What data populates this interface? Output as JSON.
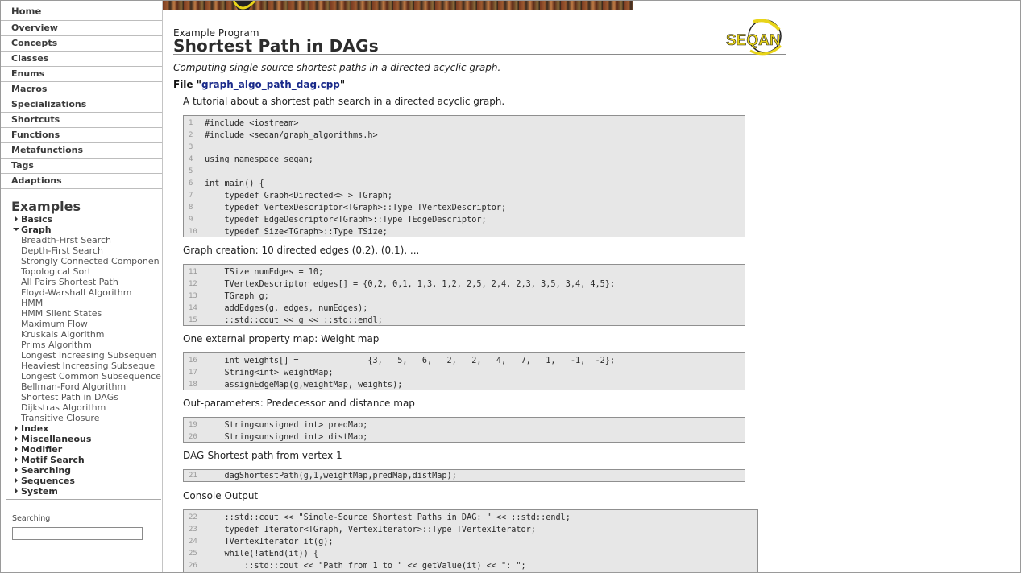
{
  "sidebar": {
    "nav": [
      {
        "label": "Home"
      },
      {
        "label": "Overview"
      },
      {
        "label": "Concepts"
      },
      {
        "label": "Classes"
      },
      {
        "label": "Enums"
      },
      {
        "label": "Macros"
      },
      {
        "label": "Specializations"
      },
      {
        "label": "Shortcuts"
      },
      {
        "label": "Functions"
      },
      {
        "label": "Metafunctions"
      },
      {
        "label": "Tags"
      },
      {
        "label": "Adaptions"
      }
    ],
    "examples_heading": "Examples",
    "categories_before": [
      {
        "label": "Basics",
        "expanded": false
      }
    ],
    "graph_category": {
      "label": "Graph",
      "expanded": true
    },
    "graph_items": [
      "Breadth-First Search",
      "Depth-First Search",
      "Strongly Connected Componen",
      "Topological Sort",
      "All Pairs Shortest Path",
      "Floyd-Warshall Algorithm",
      "HMM",
      "HMM Silent States",
      "Maximum Flow",
      "Kruskals Algorithm",
      "Prims Algorithm",
      "Longest Increasing Subsequen",
      "Heaviest Increasing Subseque",
      "Longest Common Subsequence",
      "Bellman-Ford Algorithm",
      "Shortest Path in DAGs",
      "Dijkstras Algorithm",
      "Transitive Closure"
    ],
    "categories_after": [
      {
        "label": "Index",
        "expanded": false
      },
      {
        "label": "Miscellaneous",
        "expanded": false
      },
      {
        "label": "Modifier",
        "expanded": false
      },
      {
        "label": "Motif Search",
        "expanded": false
      },
      {
        "label": "Searching",
        "expanded": false
      },
      {
        "label": "Sequences",
        "expanded": false
      },
      {
        "label": "System",
        "expanded": false
      }
    ],
    "search_label": "Searching",
    "search_value": ""
  },
  "page": {
    "kind": "Example Program",
    "title": "Shortest Path in DAGs",
    "logo_text": "SEQAN",
    "summary": "Computing single source shortest paths in a directed acyclic graph.",
    "file_prefix": "File \"",
    "file_name": "graph_algo_path_dag.cpp",
    "file_suffix": "\""
  },
  "sections": [
    {
      "description": "A tutorial about a shortest path search in a directed acyclic graph.",
      "lines": [
        {
          "n": "1",
          "code": "#include <iostream>"
        },
        {
          "n": "2",
          "code": "#include <seqan/graph_algorithms.h>"
        },
        {
          "n": "3",
          "code": ""
        },
        {
          "n": "4",
          "code": "using namespace seqan;"
        },
        {
          "n": "5",
          "code": ""
        },
        {
          "n": "6",
          "code": "int main() {"
        },
        {
          "n": "7",
          "code": "    typedef Graph<Directed<> > TGraph;"
        },
        {
          "n": "8",
          "code": "    typedef VertexDescriptor<TGraph>::Type TVertexDescriptor;"
        },
        {
          "n": "9",
          "code": "    typedef EdgeDescriptor<TGraph>::Type TEdgeDescriptor;"
        },
        {
          "n": "10",
          "code": "    typedef Size<TGraph>::Type TSize;"
        }
      ]
    },
    {
      "description": "Graph creation: 10 directed edges (0,2), (0,1), ...",
      "lines": [
        {
          "n": "11",
          "code": "    TSize numEdges = 10;"
        },
        {
          "n": "12",
          "code": "    TVertexDescriptor edges[] = {0,2, 0,1, 1,3, 1,2, 2,5, 2,4, 2,3, 3,5, 3,4, 4,5};"
        },
        {
          "n": "13",
          "code": "    TGraph g;"
        },
        {
          "n": "14",
          "code": "    addEdges(g, edges, numEdges);"
        },
        {
          "n": "15",
          "code": "    ::std::cout << g << ::std::endl;"
        }
      ]
    },
    {
      "description": "One external property map: Weight map",
      "lines": [
        {
          "n": "16",
          "code": "    int weights[] =              {3,   5,   6,   2,   2,   4,   7,   1,   -1,  -2};"
        },
        {
          "n": "17",
          "code": "    String<int> weightMap;"
        },
        {
          "n": "18",
          "code": "    assignEdgeMap(g,weightMap, weights);"
        }
      ]
    },
    {
      "description": "Out-parameters: Predecessor and distance map",
      "lines": [
        {
          "n": "19",
          "code": "    String<unsigned int> predMap;"
        },
        {
          "n": "20",
          "code": "    String<unsigned int> distMap;"
        }
      ]
    },
    {
      "description": "DAG-Shortest path from vertex 1",
      "lines": [
        {
          "n": "21",
          "code": "    dagShortestPath(g,1,weightMap,predMap,distMap);"
        }
      ]
    },
    {
      "description": "Console Output",
      "lines": [
        {
          "n": "22",
          "code": "    ::std::cout << \"Single-Source Shortest Paths in DAG: \" << ::std::endl;"
        },
        {
          "n": "23",
          "code": "    typedef Iterator<TGraph, VertexIterator>::Type TVertexIterator;"
        },
        {
          "n": "24",
          "code": "    TVertexIterator it(g);"
        },
        {
          "n": "25",
          "code": "    while(!atEnd(it)) {"
        },
        {
          "n": "26",
          "code": "        ::std::cout << \"Path from 1 to \" << getValue(it) << \": \";"
        }
      ]
    }
  ]
}
